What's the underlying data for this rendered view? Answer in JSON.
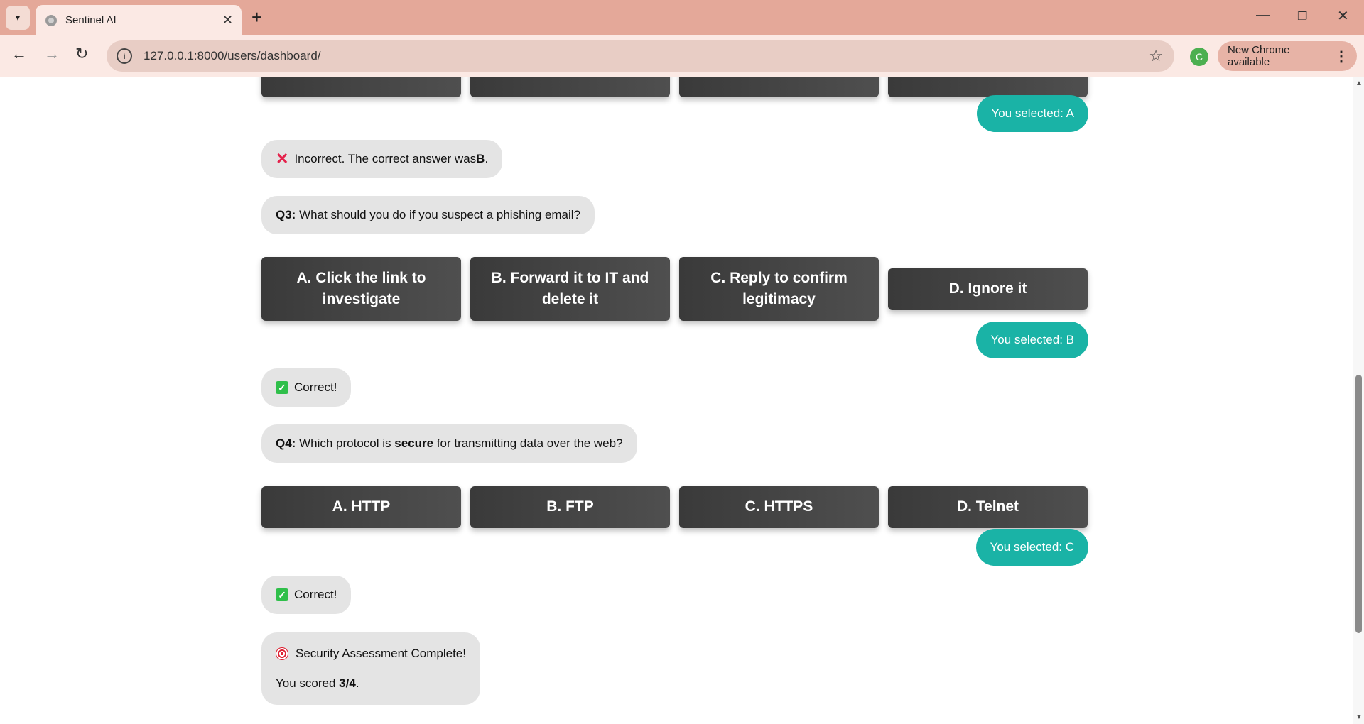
{
  "browser": {
    "tab_title": "Sentinel AI",
    "url": "127.0.0.1:8000/users/dashboard/",
    "profile_initial": "C",
    "update_label": "New Chrome available"
  },
  "chat": {
    "sel_q2": "You selected: A",
    "feedback_q2_prefix": "Incorrect. The correct answer was ",
    "feedback_q2_answer": "B",
    "feedback_q2_suffix": ".",
    "q3_label": "Q3:",
    "q3_text": " What should you do if you suspect a phishing email?",
    "q3_options": [
      "A. Click the link to investigate",
      "B. Forward it to IT and delete it",
      "C. Reply to confirm legitimacy",
      "D. Ignore it"
    ],
    "sel_q3": "You selected: B",
    "feedback_q3": "Correct!",
    "q4_label": "Q4:",
    "q4_text_a": " Which protocol is ",
    "q4_text_bold": "secure",
    "q4_text_b": " for transmitting data over the web?",
    "q4_options": [
      "A. HTTP",
      "B. FTP",
      "C. HTTPS",
      "D. Telnet"
    ],
    "sel_q4": "You selected: C",
    "feedback_q4": "Correct!",
    "summary_title": "Security Assessment Complete!",
    "summary_prefix": "You scored ",
    "summary_score": "3/4",
    "summary_suffix": "."
  },
  "icons": {
    "wrong": "cross-mark-icon",
    "right": "check-mark-icon",
    "target": "target-icon"
  },
  "colors": {
    "accent_teal": "#1ab3a6",
    "option_button": "#3a3a3a",
    "bot_bubble": "#e4e4e4",
    "chrome_frame": "#e4a899"
  }
}
